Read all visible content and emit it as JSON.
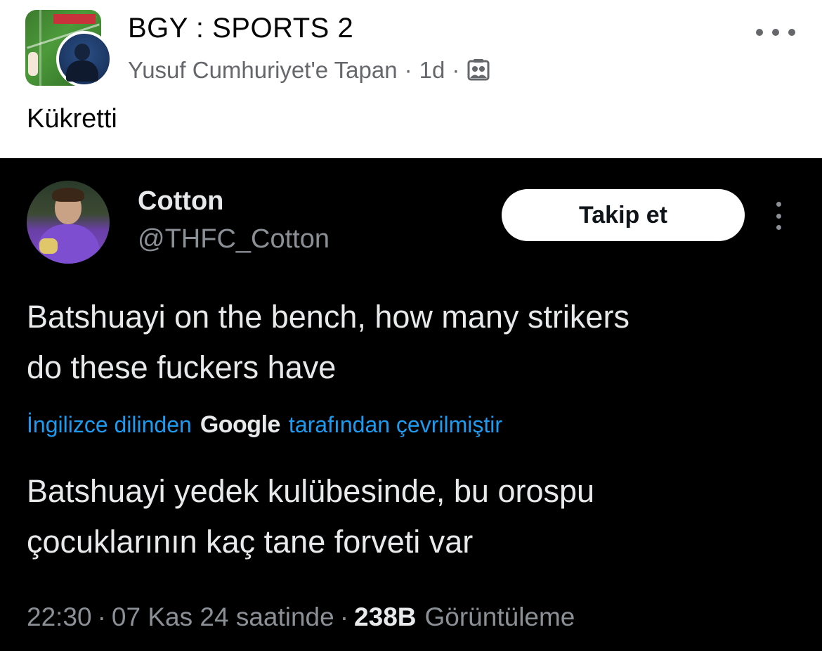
{
  "post": {
    "group_name": "BGY : SPORTS 2",
    "author": "Yusuf Cumhuriyet'e Tapan",
    "separator": "·",
    "time": "1d",
    "privacy_icon": "group-members-icon",
    "more_icon": "more-horizontal-icon",
    "text": "Kükretti"
  },
  "tweet": {
    "display_name": "Cotton",
    "handle": "@THFC_Cotton",
    "follow_label": "Takip et",
    "more_icon": "more-vertical-icon",
    "body_lines": [
      "Batshuayi on the bench, how many strikers",
      "do these fuckers have"
    ],
    "translation": {
      "prefix": "İngilizce dilinden",
      "brand": "Google",
      "suffix": "tarafından çevrilmiştir"
    },
    "translated_lines": [
      "Batshuayi yedek kulübesinde, bu orospu",
      "çocuklarının kaç tane forveti var"
    ],
    "footer": {
      "time": "22:30",
      "separator": "·",
      "date": "07 Kas 24 saatinde",
      "views_count": "238B",
      "views_label": "Görüntüleme"
    }
  },
  "colors": {
    "fb_text": "#050505",
    "fb_meta": "#65676b",
    "tweet_bg": "#000000",
    "tweet_text": "#e7e9ea",
    "tweet_muted": "#8b9096",
    "link_blue": "#1d9bf0"
  }
}
